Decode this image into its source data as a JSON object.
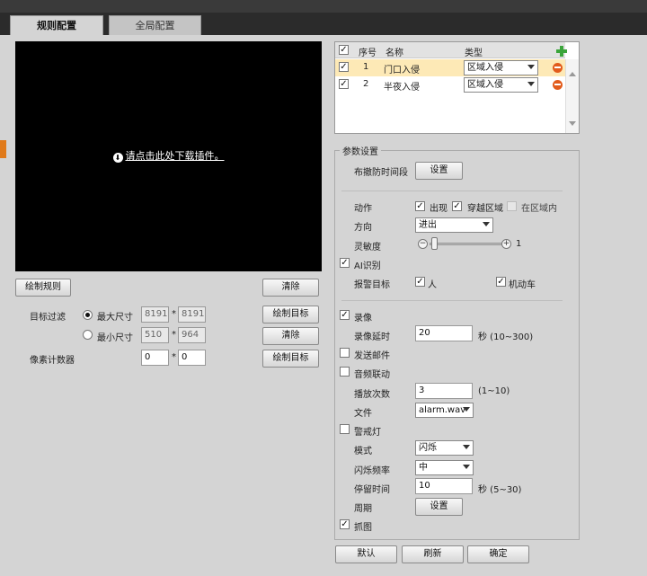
{
  "tabs": {
    "active": "规则配置",
    "inactive": "全局配置"
  },
  "preview": {
    "plugin_link": "请点击此处下载插件。",
    "icon": "download-icon"
  },
  "left": {
    "draw_rule": "绘制规则",
    "clear": "清除",
    "target_filter": "目标过滤",
    "max_size_label": "最大尺寸",
    "max_w": "8191",
    "max_h": "8191",
    "draw_target": "绘制目标",
    "min_size_label": "最小尺寸",
    "min_w": "510",
    "min_h": "964",
    "clear2": "清除",
    "pixel_counter": "像素计数器",
    "px_w": "0",
    "px_h": "0",
    "draw_target2": "绘制目标",
    "star": "*"
  },
  "rules": {
    "headers": {
      "index": "序号",
      "name": "名称",
      "type": "类型"
    },
    "rows": [
      {
        "index": "1",
        "name": "门口入侵",
        "type": "区域入侵"
      },
      {
        "index": "2",
        "name": "半夜入侵",
        "type": "区域入侵"
      }
    ]
  },
  "params": {
    "title": "参数设置",
    "schedule_label": "布撤防时间段",
    "setup": "设置",
    "action_label": "动作",
    "appear": "出现",
    "cross": "穿越区域",
    "inside": "在区域内",
    "direction_label": "方向",
    "direction_value": "进出",
    "sensitivity_label": "灵敏度",
    "sensitivity_value": "1",
    "ai_label": "AI识别",
    "alarm_target_label": "报警目标",
    "person": "人",
    "vehicle": "机动车",
    "record_label": "录像",
    "record_delay_label": "录像延时",
    "record_delay_value": "20",
    "record_delay_unit": "秒 (10~300)",
    "email_label": "发送邮件",
    "audio_label": "音频联动",
    "play_count_label": "播放次数",
    "play_count_value": "3",
    "play_count_range": "(1~10)",
    "file_label": "文件",
    "file_value": "alarm.wav",
    "warning_light_label": "警戒灯",
    "mode_label": "模式",
    "mode_value": "闪烁",
    "freq_label": "闪烁频率",
    "freq_value": "中",
    "stay_label": "停留时间",
    "stay_value": "10",
    "stay_unit": "秒 (5~30)",
    "period_label": "周期",
    "period_setup": "设置",
    "snapshot_label": "抓图"
  },
  "footer": {
    "default": "默认",
    "refresh": "刷新",
    "confirm": "确定"
  }
}
